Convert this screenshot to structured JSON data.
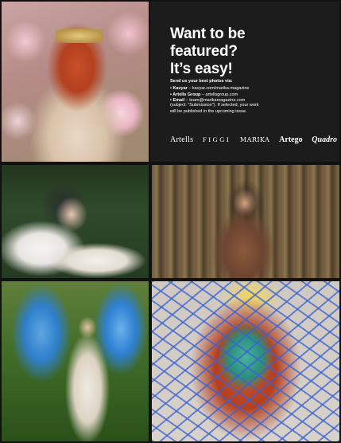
{
  "panel": {
    "headline": "Want to be\nfeatured?\nIt’s easy!",
    "intro": "Send us your best photos via:",
    "contacts": [
      {
        "label": "• Kavyar",
        "value": " – kavyar.com/marika-magazine"
      },
      {
        "label": "• Artells Group",
        "value": " – artellsgroup.com"
      },
      {
        "label": "• Email",
        "value": " – team@marikamagazine.com"
      }
    ],
    "note": "(subject: \"Submission\"). If selected, your work\nwill be published in the upcoming issue.",
    "logos": [
      "Artells",
      "FIGGI",
      "MARIKA",
      "Artego",
      "Quadro"
    ]
  },
  "photos": [
    {
      "subject": "woman-with-magnolias"
    },
    {
      "subject": "woman-at-fountain"
    },
    {
      "subject": "woman-in-bamboo"
    },
    {
      "subject": "woman-with-blue-wings"
    },
    {
      "subject": "woman-under-net"
    }
  ]
}
